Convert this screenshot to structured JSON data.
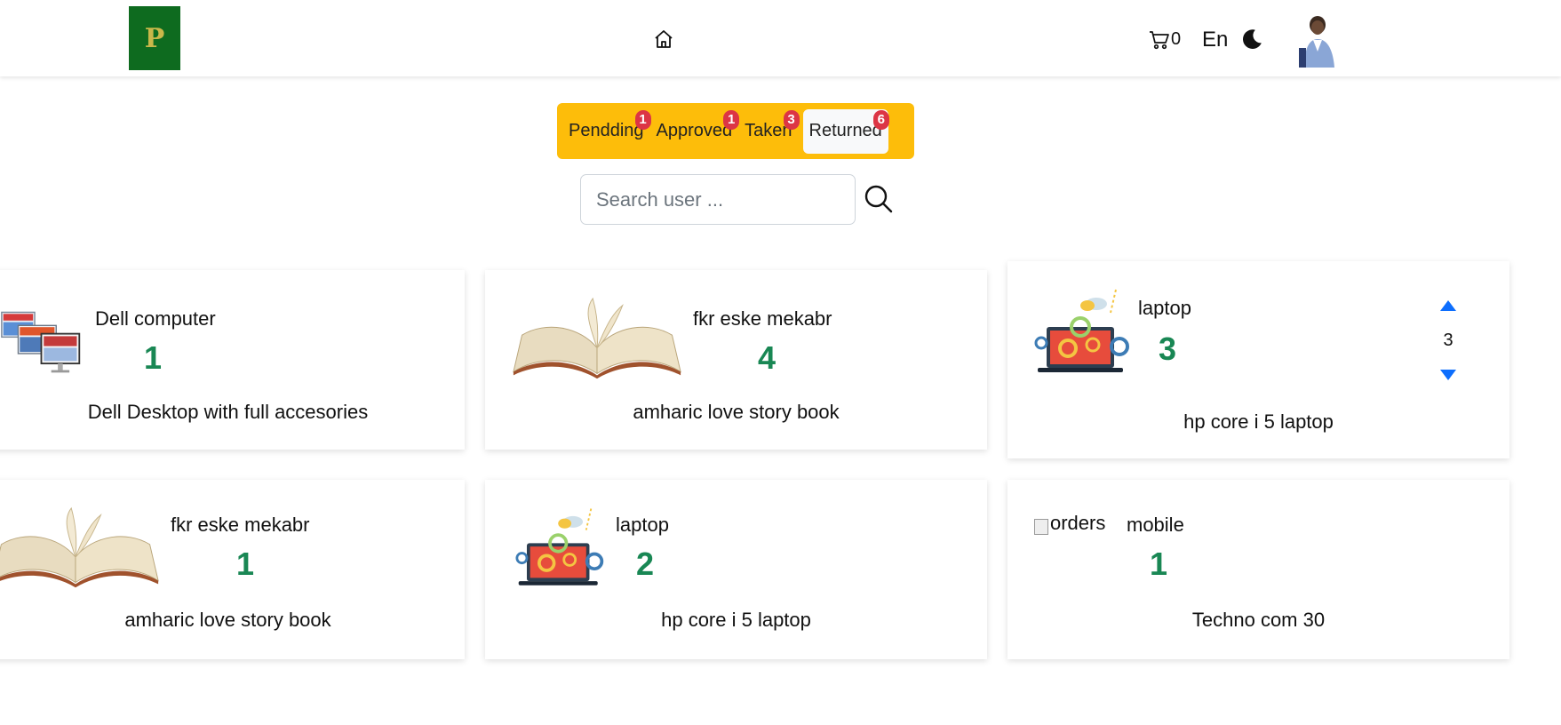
{
  "navbar": {
    "cart_count": "0",
    "language": "En",
    "icons": {
      "home": "home-icon",
      "cart": "cart-icon",
      "theme": "moon-icon",
      "search": "search-icon"
    }
  },
  "tabs": [
    {
      "label": "Pendding",
      "count": "1"
    },
    {
      "label": "Approved",
      "count": "1"
    },
    {
      "label": "Taken",
      "count": "3"
    },
    {
      "label": "Returned",
      "count": "6"
    }
  ],
  "search": {
    "placeholder": "Search user ..."
  },
  "cards": [
    {
      "name": "Dell computer",
      "quantity": "1",
      "description": "Dell Desktop with full accesories"
    },
    {
      "name": "fkr eske mekabr",
      "quantity": "4",
      "description": "amharic love story book"
    },
    {
      "name": "laptop",
      "quantity": "3",
      "description": "hp core i 5 laptop",
      "stepper_value": "3"
    },
    {
      "name": "fkr eske mekabr",
      "quantity": "1",
      "description": "amharic love story book"
    },
    {
      "name": "laptop",
      "quantity": "2",
      "description": "hp core i 5 laptop"
    },
    {
      "name": "mobile",
      "quantity": "1",
      "description": "Techno com 30",
      "broken_image_alt": "orders"
    }
  ],
  "colors": {
    "accent": "#fdbd0a",
    "badge": "#dc3545",
    "quantity": "#198754",
    "logo_bg": "#0e6b1f",
    "stepper": "#0d6efd"
  }
}
